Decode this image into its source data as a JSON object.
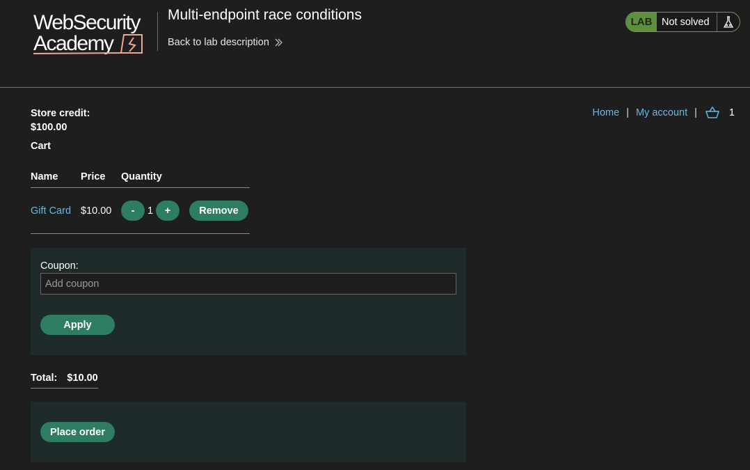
{
  "header": {
    "logo_line1": "WebSecurity",
    "logo_line2": "Academy",
    "lab_title": "Multi-endpoint race conditions",
    "back_link": "Back to lab description",
    "status_badge": "LAB",
    "status_text": "Not solved"
  },
  "nav": {
    "home": "Home",
    "separator": "|",
    "account": "My account",
    "cart_count": "1"
  },
  "store_credit": {
    "label": "Store credit:",
    "value": "$100.00"
  },
  "cart": {
    "heading": "Cart",
    "columns": [
      "Name",
      "Price",
      "Quantity"
    ],
    "items": [
      {
        "name": "Gift Card",
        "price": "$10.00",
        "quantity": "1"
      }
    ],
    "decrement_label": "-",
    "increment_label": "+",
    "remove_label": "Remove"
  },
  "coupon": {
    "label": "Coupon:",
    "placeholder": "Add coupon",
    "apply_label": "Apply"
  },
  "total": {
    "label": "Total:",
    "value": "$10.00"
  },
  "order": {
    "place_label": "Place order"
  },
  "colors": {
    "accent_orange": "#c2532b",
    "link_blue": "#6ab7df",
    "button_green": "#2e7d62",
    "lab_green": "#5e8f3e"
  }
}
